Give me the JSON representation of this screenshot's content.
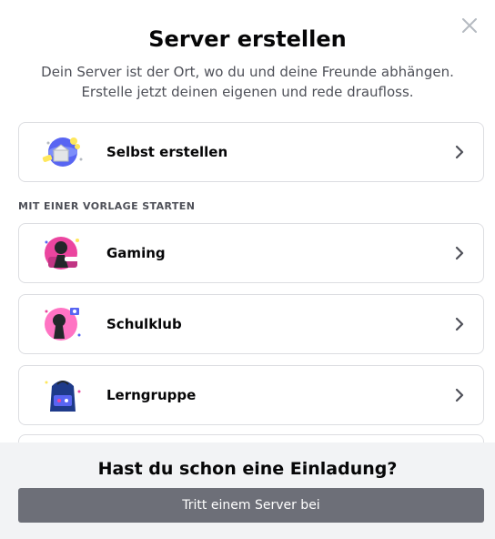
{
  "modal": {
    "title": "Server erstellen",
    "subtitle_line1": "Dein Server ist der Ort, wo du und deine Freunde abhängen.",
    "subtitle_line2": "Erstelle jetzt deinen eigenen und rede draufloss."
  },
  "options": {
    "create_own": {
      "label": "Selbst erstellen",
      "icon": "globe-build-icon"
    },
    "section_label": "MIT EINER VORLAGE STARTEN",
    "templates": [
      {
        "label": "Gaming",
        "icon": "gaming-icon"
      },
      {
        "label": "Schulklub",
        "icon": "school-club-icon"
      },
      {
        "label": "Lerngruppe",
        "icon": "backpack-icon"
      }
    ]
  },
  "footer": {
    "title": "Hast du schon eine Einladung?",
    "button_label": "Tritt einem Server bei"
  },
  "colors": {
    "button_bg": "#6d6f78",
    "footer_bg": "#f2f3f5",
    "text_primary": "#060607",
    "text_secondary": "#4e5058",
    "border": "#dcdde1"
  }
}
